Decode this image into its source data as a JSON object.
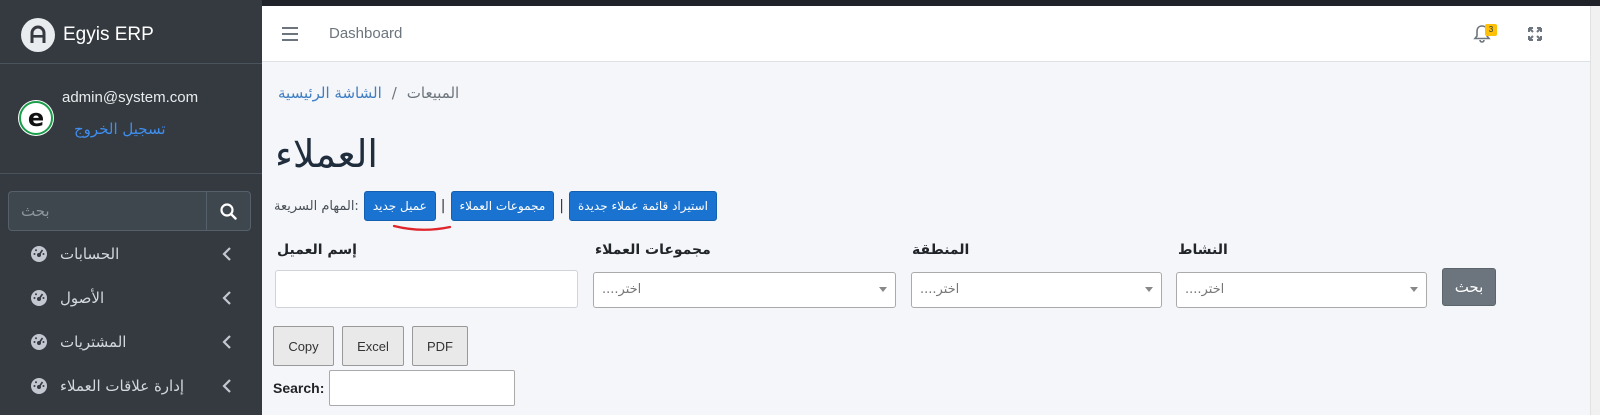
{
  "brand": {
    "name": "Egyis ERP"
  },
  "user": {
    "email": "admin@system.com",
    "logout": "تسجيل الخروج"
  },
  "sidebar": {
    "search_placeholder": "بحث",
    "items": [
      {
        "label": "الحسابات",
        "icon": "gauge-icon"
      },
      {
        "label": "الأصول",
        "icon": "gauge-icon"
      },
      {
        "label": "المشتريات",
        "icon": "gauge-icon"
      },
      {
        "label": "إدارة علاقات العملاء",
        "icon": "gauge-icon"
      }
    ]
  },
  "navbar": {
    "title": "Dashboard",
    "notifications_count": "3"
  },
  "breadcrumb": {
    "home": "الشاشة الرئيسية",
    "separator": "/",
    "current": "المبيعات"
  },
  "page": {
    "title": "العملاء"
  },
  "quick_tasks": {
    "label": ":المهام السريعة",
    "buttons": [
      "عميل جديد",
      "مجموعات العملاء",
      "استيراد قائمة عملاء جديدة"
    ],
    "separator": "|"
  },
  "filters": {
    "customer_name": {
      "label": "إسم العميل",
      "value": ""
    },
    "customer_groups": {
      "label": "مجموعات العملاء",
      "placeholder": "اختر...."
    },
    "region": {
      "label": "المنطقة",
      "placeholder": "اختر...."
    },
    "activity": {
      "label": "النشاط",
      "placeholder": "اختر...."
    },
    "search_button": "بحث"
  },
  "table_tools": {
    "buttons": [
      "Copy",
      "Excel",
      "PDF"
    ],
    "search_label": "Search:",
    "search_value": ""
  },
  "colors": {
    "sidebar_bg": "#343a40",
    "primary": "#1a73d1",
    "secondary": "#6c757d",
    "annotation_underline": "#e0242b"
  }
}
